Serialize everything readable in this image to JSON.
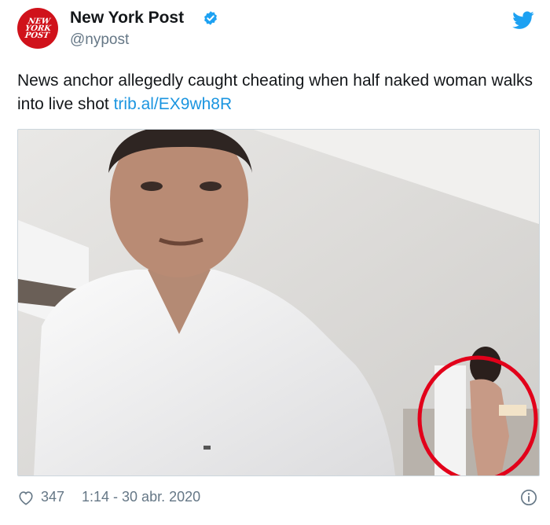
{
  "account": {
    "logo_text": "NEW\nYORK\nPOST",
    "display_name": "New York Post",
    "handle": "@nypost",
    "verified": true,
    "brand_color": "#d0121b"
  },
  "tweet": {
    "text": "News anchor allegedly caught cheating when half naked woman walks into live shot ",
    "link": "trib.al/EX9wh8R",
    "link_color": "#1b95e0"
  },
  "media": {
    "highlight_color": "#e2001a"
  },
  "footer": {
    "like_count": "347",
    "timestamp": "1:14 - 30 abr. 2020"
  },
  "icons": {
    "like": "heart-outline-icon",
    "info": "info-icon",
    "platform": "twitter-bird-icon",
    "verified": "verified-badge-icon"
  }
}
